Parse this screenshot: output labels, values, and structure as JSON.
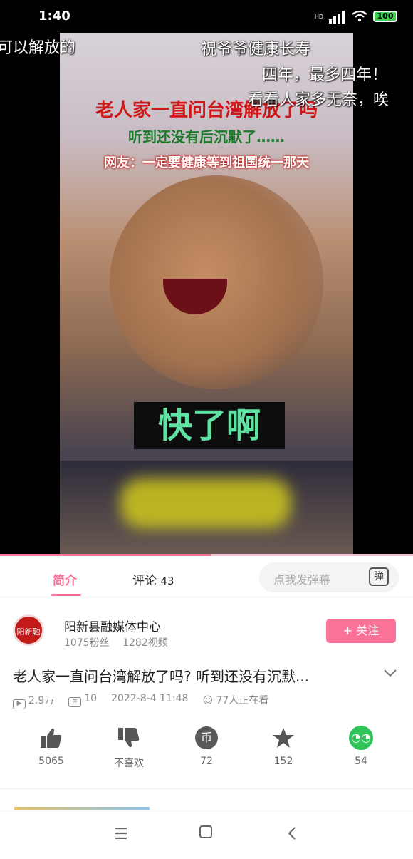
{
  "status_bar": {
    "time": "1:40",
    "signal_label": "HD",
    "battery": "100"
  },
  "video": {
    "danmaku": [
      "可以解放的",
      "祝爷爷健康长寿",
      "四年，最多四年！",
      "看看人家多无奈，唉"
    ],
    "title_red": "老人家一直问台湾解放了吗",
    "title_green": "听到还没有后沉默了……",
    "title_white": "网友：一定要健康等到祖国统一那天",
    "subtitle": "快了啊",
    "progress": 0.51
  },
  "tabs": {
    "intro": "简介",
    "comments_label": "评论",
    "comments_count": "43",
    "danmaku_placeholder": "点我发弹幕",
    "danmaku_button": "弹"
  },
  "channel": {
    "avatar_text": "阳新融媒",
    "name": "阳新县融媒体中心",
    "fans": "1075粉丝",
    "videos": "1282视频",
    "follow": "+ 关注"
  },
  "video_info": {
    "title": "老人家一直问台湾解放了吗? 听到还没有沉默...",
    "views": "2.9万",
    "danmaku_count": "10",
    "date": "2022-8-4 11:48",
    "watching": "77人正在看"
  },
  "actions": {
    "like": "5065",
    "dislike": "不喜欢",
    "coin": "72",
    "favorite": "152",
    "share": "54"
  },
  "icons": {
    "like": "thumbs-up-icon",
    "dislike": "thumbs-down-icon",
    "coin": "coin-icon",
    "favorite": "star-icon",
    "share": "wechat-icon"
  },
  "colors": {
    "accent": "#fb7299",
    "wechat": "#2fc55a",
    "subtitle": "#5fe3a3"
  }
}
